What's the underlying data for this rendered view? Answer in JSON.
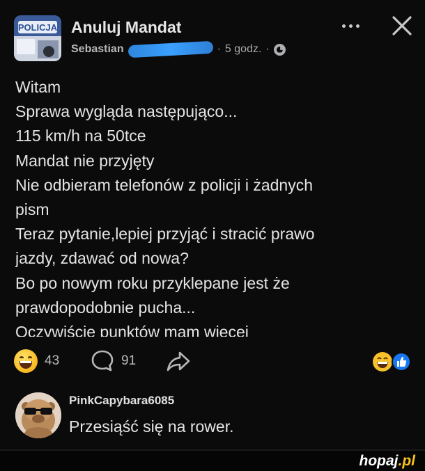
{
  "post": {
    "group_title": "Anuluj Mandat",
    "author_name": "Sebastian",
    "time": "5 godz.",
    "body_lines": [
      "Witam",
      "Sprawa wygląda następująco...",
      "115 km/h na 50tce",
      "Mandat nie przyjęty",
      "Nie odbieram telefonów z policji i żadnych",
      "pism",
      "Teraz pytanie,lepiej przyjąć i stracić prawo",
      "jazdy, zdawać od nowa?",
      "Bo po nowym roku przyklepane jest że",
      "prawdopodobnie pucha...",
      "Oczywiście punktów mam więcej"
    ],
    "reactions_count": "43",
    "comments_count": "91",
    "thumb_text": "POLICJA"
  },
  "comment": {
    "username": "PinkCapybara6085",
    "text": "Przesiąść się na rower."
  },
  "watermark": {
    "name": "hopaj",
    "tld": ".pl"
  },
  "icons": {
    "more": "more-options-icon",
    "close": "close-icon",
    "privacy": "globe-icon",
    "comment": "comment-bubble-icon",
    "share": "share-arrow-icon",
    "reaction_haha": "haha-emoji-icon",
    "reaction_like": "like-icon"
  },
  "colors": {
    "background": "#0b0b0c",
    "text_primary": "#e4e4e4",
    "text_secondary": "#a8a8ab",
    "like_blue": "#1877f2",
    "watermark_yellow": "#f7c21a"
  }
}
